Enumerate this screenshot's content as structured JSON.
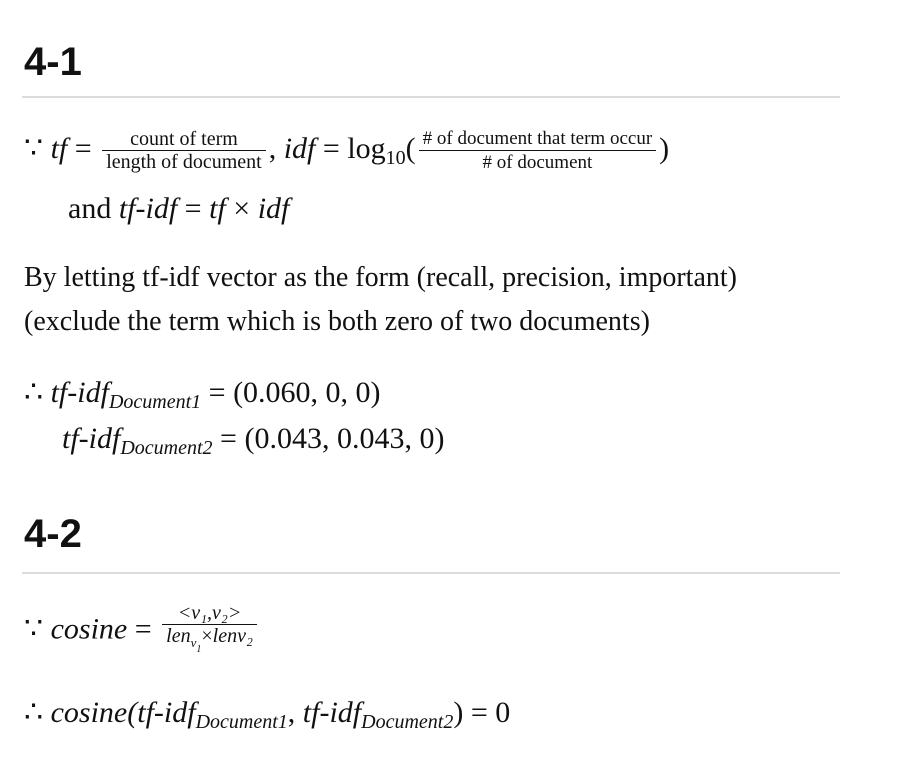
{
  "sections": [
    {
      "heading": "4-1"
    },
    {
      "heading": "4-2"
    }
  ],
  "s1": {
    "because": "∵",
    "tf": "tf",
    "eq": "=",
    "tf_num": "count of term",
    "tf_den": "length of document",
    "comma": ",",
    "idf": "idf",
    "log": "log",
    "log_base": "10",
    "lparen": "(",
    "idf_num": "# of document that term occur",
    "idf_den": "# of document",
    "rparen": ")",
    "and": "and",
    "tfidf": "tf-idf",
    "times": "×",
    "prose_line1": "By letting tf-idf vector as the form (recall, precision, important)",
    "prose_line2": "(exclude the term which is both zero of two documents)",
    "therefore": "∴",
    "doc1_sub": "Document1",
    "doc1_val": "(0.060, 0, 0)",
    "doc2_sub": "Document2",
    "doc2_val": "(0.043, 0.043, 0)"
  },
  "s2": {
    "because": "∵",
    "cosine": "cosine",
    "eq": "=",
    "num": "<v₁,v₂>",
    "den_len": "len",
    "den_sub_v": "v",
    "den_sub_1": "1",
    "den_times": "×",
    "den_lenv2": "lenv₂",
    "therefore": "∴",
    "cos_call_open": "cosine(",
    "tfidf": "tf-idf",
    "doc1_sub": "Document1",
    "sep": ",",
    "doc2_sub": "Document2",
    "close": ")",
    "result": "0"
  }
}
